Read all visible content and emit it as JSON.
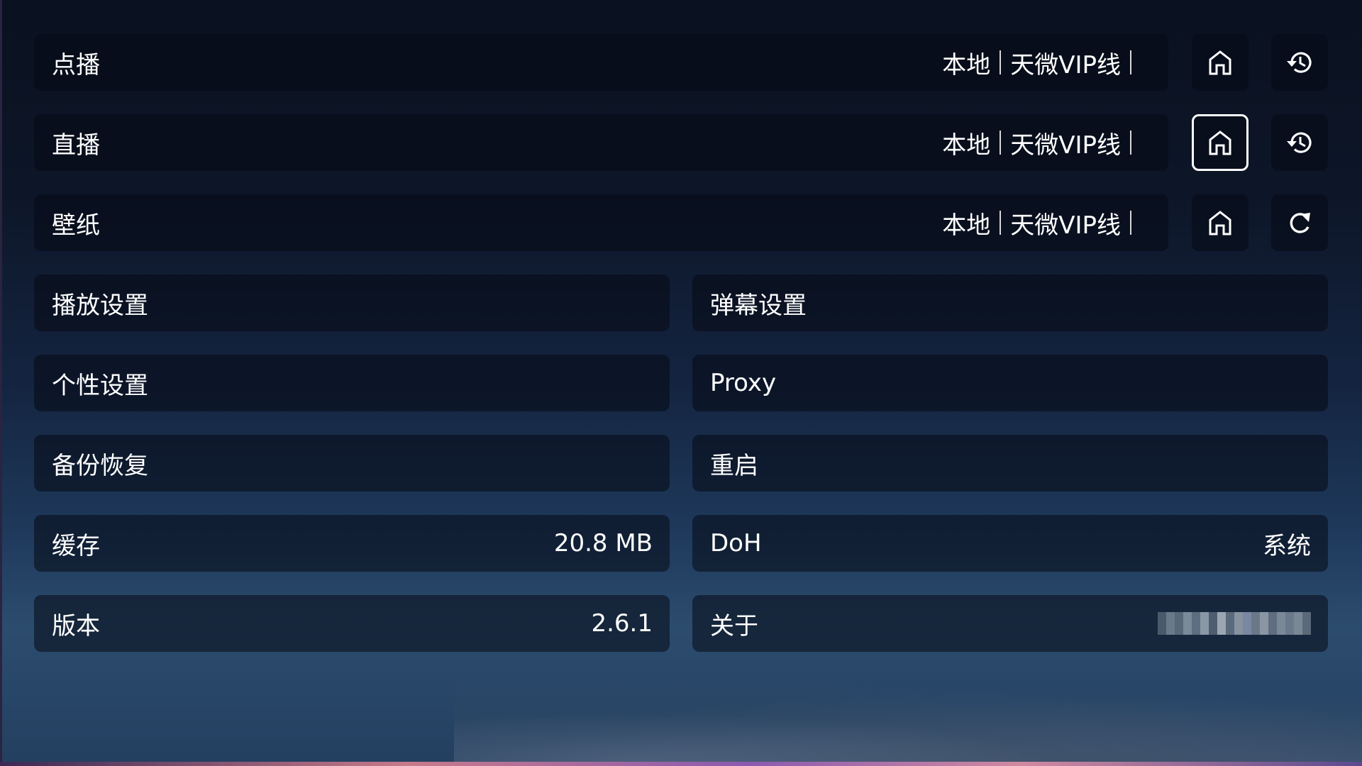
{
  "source_rows": [
    {
      "label": "点播",
      "sources": [
        "本地",
        "天微VIP线"
      ],
      "home_icon": "home-icon",
      "action_icon": "history-icon",
      "home_focused": false
    },
    {
      "label": "直播",
      "sources": [
        "本地",
        "天微VIP线"
      ],
      "home_icon": "home-icon",
      "action_icon": "history-icon",
      "home_focused": true
    },
    {
      "label": "壁纸",
      "sources": [
        "本地",
        "天微VIP线"
      ],
      "home_icon": "home-icon",
      "action_icon": "refresh-icon",
      "home_focused": false
    }
  ],
  "settings": {
    "playback": {
      "label": "播放设置"
    },
    "danmaku": {
      "label": "弹幕设置"
    },
    "personal": {
      "label": "个性设置"
    },
    "proxy": {
      "label": "Proxy"
    },
    "backup": {
      "label": "备份恢复"
    },
    "restart": {
      "label": "重启"
    },
    "cache": {
      "label": "缓存",
      "value": "20.8 MB"
    },
    "doh": {
      "label": "DoH",
      "value": "系统"
    },
    "version": {
      "label": "版本",
      "value": "2.6.1"
    },
    "about": {
      "label": "关于",
      "value_redacted": true
    }
  },
  "colors": {
    "background_top": "#0a1120",
    "background_bottom": "#2c4c6e",
    "text": "#ffffff",
    "focus_border": "#ffffff"
  }
}
